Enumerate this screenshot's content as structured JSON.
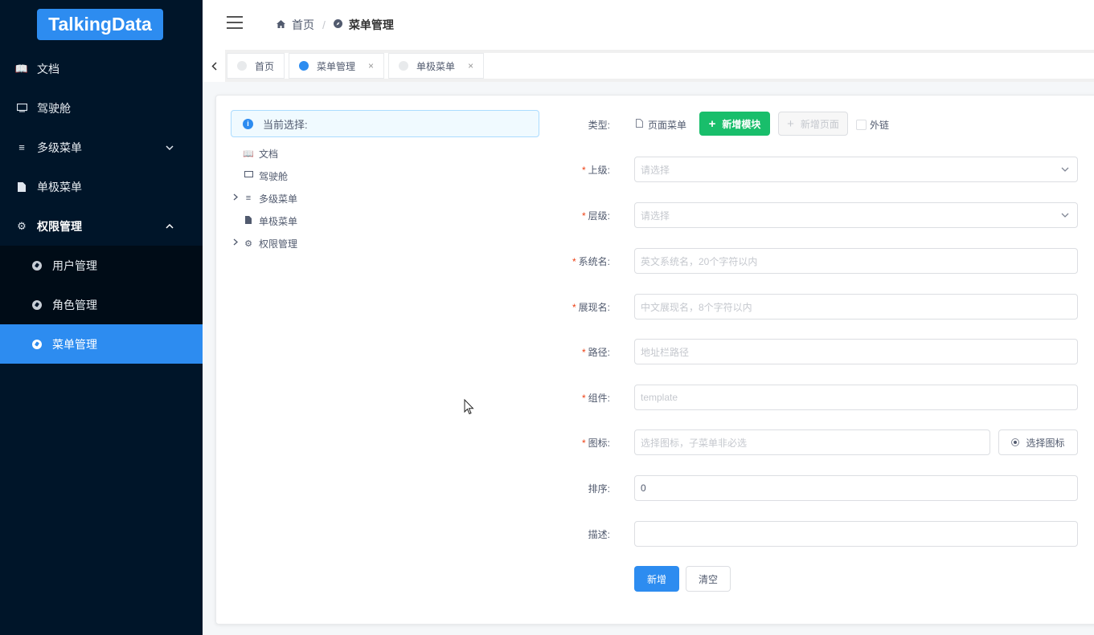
{
  "logo": "TalkingData",
  "sidebar": {
    "items": [
      {
        "label": "文档",
        "icon": "book-icon"
      },
      {
        "label": "驾驶舱",
        "icon": "monitor-icon"
      },
      {
        "label": "多级菜单",
        "icon": "menu-lines-icon",
        "arrow": "chevron-down-icon"
      },
      {
        "label": "单极菜单",
        "icon": "file-icon"
      },
      {
        "label": "权限管理",
        "icon": "gear-icon",
        "arrow": "chevron-up-icon"
      }
    ],
    "sub_items": [
      {
        "label": "用户管理"
      },
      {
        "label": "角色管理"
      },
      {
        "label": "菜单管理",
        "active": true
      }
    ]
  },
  "header": {
    "breadcrumb_home": "首页",
    "breadcrumb_sep": "/",
    "breadcrumb_current": "菜单管理"
  },
  "tabs": [
    {
      "label": "首页"
    },
    {
      "label": "菜单管理",
      "active": true,
      "close": "×"
    },
    {
      "label": "单极菜单",
      "close": "×"
    }
  ],
  "tree": {
    "selection_label": "当前选择:",
    "nodes": [
      {
        "label": "文档",
        "icon": "book-icon"
      },
      {
        "label": "驾驶舱",
        "icon": "monitor-icon"
      },
      {
        "label": "多级菜单",
        "icon": "menu-lines-icon",
        "expandable": true
      },
      {
        "label": "单极菜单",
        "icon": "file-icon"
      },
      {
        "label": "权限管理",
        "icon": "gear-icon",
        "expandable": true
      }
    ]
  },
  "form": {
    "type_label": "类型:",
    "type_value": "页面菜单",
    "add_module": "新增模块",
    "add_page": "新增页面",
    "external_link": "外链",
    "parent_label": "上级:",
    "parent_placeholder": "请选择",
    "level_label": "层级:",
    "level_placeholder": "请选择",
    "sysname_label": "系统名:",
    "sysname_placeholder": "英文系统名，20个字符以内",
    "display_label": "展现名:",
    "display_placeholder": "中文展现名，8个字符以内",
    "path_label": "路径:",
    "path_placeholder": "地址栏路径",
    "component_label": "组件:",
    "component_placeholder": "template",
    "icon_label": "图标:",
    "icon_placeholder": "选择图标，子菜单非必选",
    "select_icon": "选择图标",
    "order_label": "排序:",
    "order_value": "0",
    "desc_label": "描述:",
    "desc_value": "",
    "submit": "新增",
    "clear": "清空"
  },
  "colors": {
    "sidebar_bg": "#001529",
    "primary": "#2d8cf0",
    "success": "#19be6b",
    "required": "#ed4014"
  }
}
